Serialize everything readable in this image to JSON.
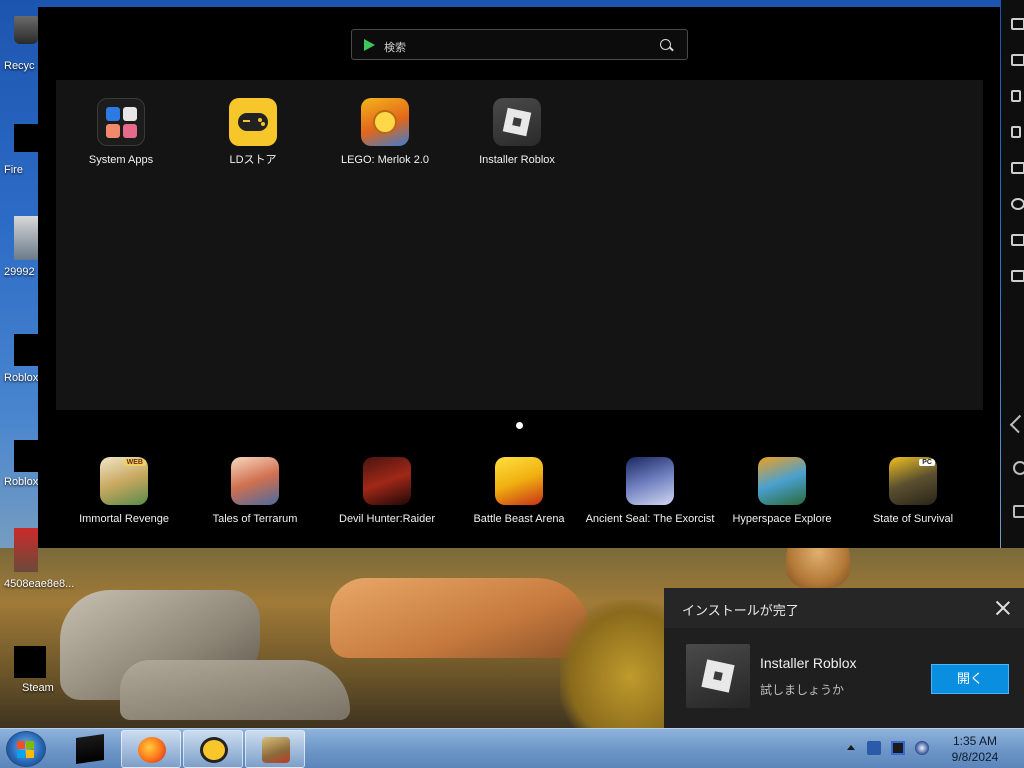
{
  "desktop": {
    "icons": [
      {
        "label": "Recyc",
        "icon": "recycle-bin-icon"
      },
      {
        "label": "Fire",
        "icon": "firefox-shortcut-icon"
      },
      {
        "label": "29992",
        "icon": "photo-file-icon"
      },
      {
        "label": "Roblox",
        "icon": "roblox-shortcut-icon"
      },
      {
        "label": "Roblox",
        "icon": "roblox-studio-shortcut-icon"
      },
      {
        "label": "4508eae8e8...",
        "icon": "image-file-icon"
      },
      {
        "label": "Steam",
        "icon": "steam-icon"
      }
    ]
  },
  "emulator": {
    "search_placeholder": "検索",
    "home_apps": [
      {
        "label": "System Apps",
        "icon": "system-apps-folder-icon"
      },
      {
        "label": "LDストア",
        "icon": "ld-store-icon",
        "color": "#f7c62a"
      },
      {
        "label": "LEGO: Merlok 2.0",
        "icon": "lego-merlok-icon"
      },
      {
        "label": "Installer Roblox",
        "icon": "roblox-installer-icon"
      }
    ],
    "dock_apps": [
      {
        "label": "Immortal Revenge",
        "icon": "immortal-revenge-icon",
        "badge": "WEB"
      },
      {
        "label": "Tales of Terrarum",
        "icon": "tales-of-terrarum-icon"
      },
      {
        "label": "Devil Hunter:Raider",
        "icon": "devil-hunter-raider-icon"
      },
      {
        "label": "Battle Beast Arena",
        "icon": "battle-beast-arena-icon"
      },
      {
        "label": "Ancient Seal: The Exorcist",
        "icon": "ancient-seal-icon"
      },
      {
        "label": "Hyperspace Explore",
        "icon": "hyperspace-explore-icon"
      },
      {
        "label": "State of Survival",
        "icon": "state-of-survival-icon",
        "badge": "PC"
      }
    ],
    "page_indicator": {
      "current": 1,
      "total": 1
    }
  },
  "toast": {
    "title": "インストールが完了",
    "app_name": "Installer Roblox",
    "subtitle": "試しましょうか",
    "open_label": "開く",
    "accent": "#0a8fe0"
  },
  "taskbar": {
    "time": "1:35 AM",
    "date": "9/8/2024",
    "pinned": [
      {
        "icon": "terminal-window-icon"
      },
      {
        "icon": "firefox-icon"
      },
      {
        "icon": "ldplayer-icon"
      },
      {
        "icon": "game-app-icon"
      }
    ]
  }
}
